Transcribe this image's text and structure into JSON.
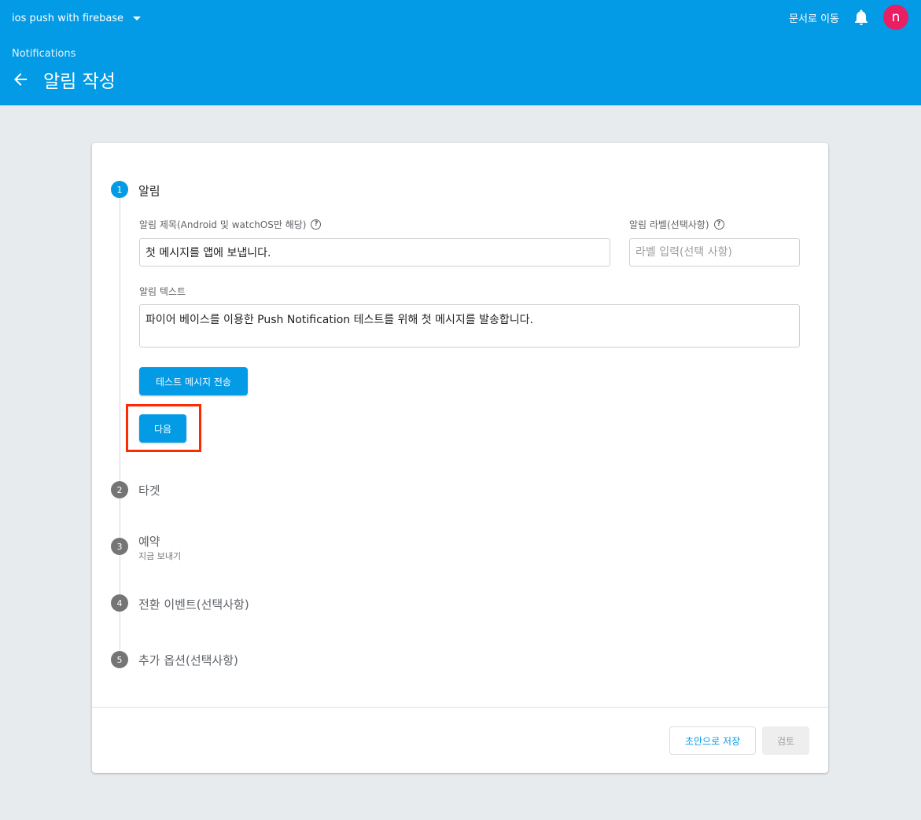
{
  "header": {
    "project_name": "ios push with firebase",
    "docs_link": "문서로 이동",
    "avatar_initial": "n",
    "breadcrumb": "Notifications",
    "title": "알림 작성",
    "bell_icon": "bell-icon",
    "back_icon": "arrow-left-icon"
  },
  "colors": {
    "header": "#039be5",
    "avatar": "#e91e63",
    "highlight": "#ff2a00",
    "background": "#e8ebee"
  },
  "steps": [
    {
      "number": "1",
      "label": "알림"
    },
    {
      "number": "2",
      "label": "타겟"
    },
    {
      "number": "3",
      "label": "예약",
      "sub": "지금 보내기"
    },
    {
      "number": "4",
      "label": "전환 이벤트(선택사항)"
    },
    {
      "number": "5",
      "label": "추가 옵션(선택사항)"
    }
  ],
  "form": {
    "title_label": "알림 제목(Android 및 watchOS만 해당)",
    "title_value": "첫 메시지를 앱에 보냅니다.",
    "label_label": "알림 라벨(선택사항)",
    "label_placeholder": "라벨 입력(선택 사항)",
    "text_label": "알림 텍스트",
    "text_value": "파이어 베이스를 이용한 Push Notification 테스트를 위해 첫 메시지를 발송합니다.",
    "test_button": "테스트 메시지 전송",
    "next_button": "다음"
  },
  "footer": {
    "save_draft": "초안으로 저장",
    "review": "검토"
  }
}
